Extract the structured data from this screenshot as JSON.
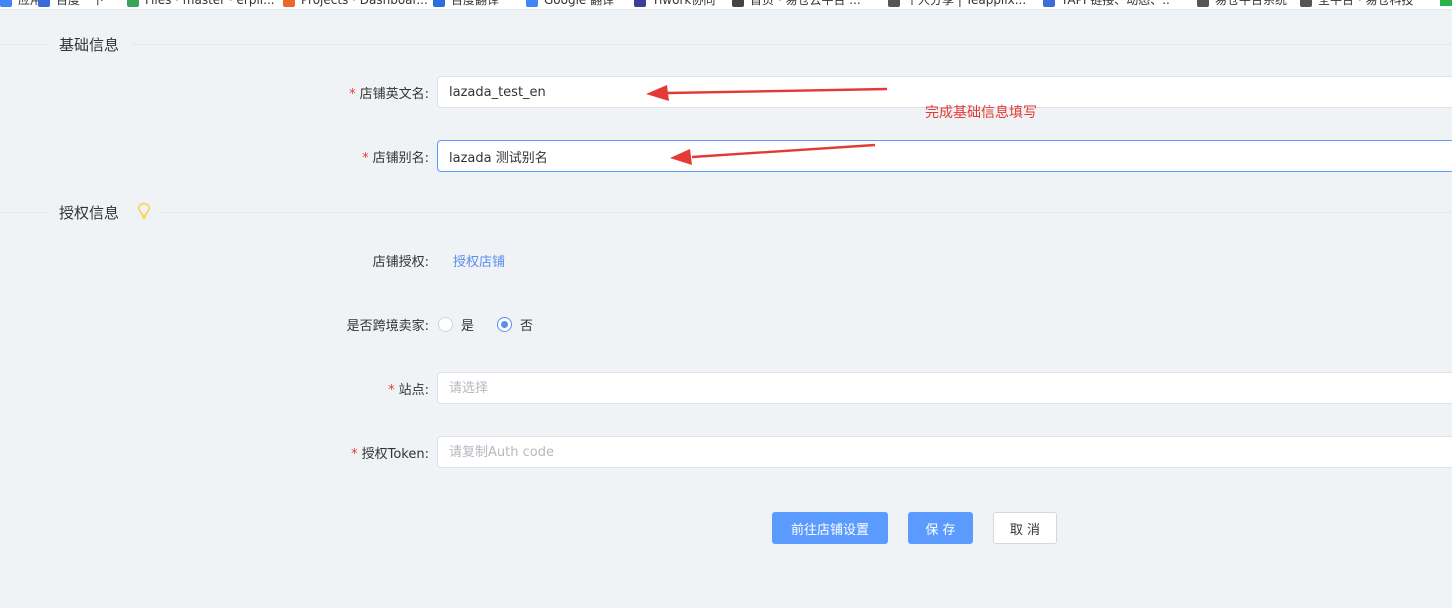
{
  "bookmarks": [
    {
      "label": "应用",
      "color": "#4285f4"
    },
    {
      "label": "百度一下",
      "color": "#3a6bd8"
    },
    {
      "label": "Files · master · erpli...",
      "color": "#3aa55a"
    },
    {
      "label": "Projects · Dashboar...",
      "color": "#e8692b"
    },
    {
      "label": "百度翻译",
      "color": "#2b6ee0"
    },
    {
      "label": "Google 翻译",
      "color": "#4285f4"
    },
    {
      "label": "Tiwork协同",
      "color": "#3b3c9e"
    },
    {
      "label": "首页 · 易仓云平台 ...",
      "color": "#444444"
    },
    {
      "label": "个人分享 | Teapplix...",
      "color": "#555555"
    },
    {
      "label": "TAPI 链接、动态、..",
      "color": "#3b6fd8"
    },
    {
      "label": "易仓平台系统",
      "color": "#555555"
    },
    {
      "label": "全平台 · 易仓科技",
      "color": "#555555"
    }
  ],
  "sections": {
    "basic": {
      "title": "基础信息"
    },
    "auth": {
      "title": "授权信息"
    }
  },
  "form": {
    "store_en_name": {
      "label": "店铺英文名:",
      "required": true,
      "value": "lazada_test_en"
    },
    "store_alias": {
      "label": "店铺别名:",
      "required": true,
      "value": "lazada 测试别名"
    },
    "store_auth": {
      "label": "店铺授权:",
      "link": "授权店铺"
    },
    "cross_border": {
      "label": "是否跨境卖家:",
      "options": [
        "是",
        "否"
      ],
      "selected": "否"
    },
    "site": {
      "label": "站点:",
      "required": true,
      "placeholder": "请选择"
    },
    "auth_token": {
      "label": "授权Token:",
      "required": true,
      "placeholder": "请复制Auth code"
    }
  },
  "buttons": {
    "goto_settings": "前往店铺设置",
    "save": "保 存",
    "cancel": "取 消"
  },
  "annotation": {
    "text": "完成基础信息填写",
    "color": "#e53935"
  },
  "colors": {
    "primary": "#5b9bff",
    "link": "#5b8dee",
    "required": "#e53935",
    "background": "#f0f3f6"
  }
}
